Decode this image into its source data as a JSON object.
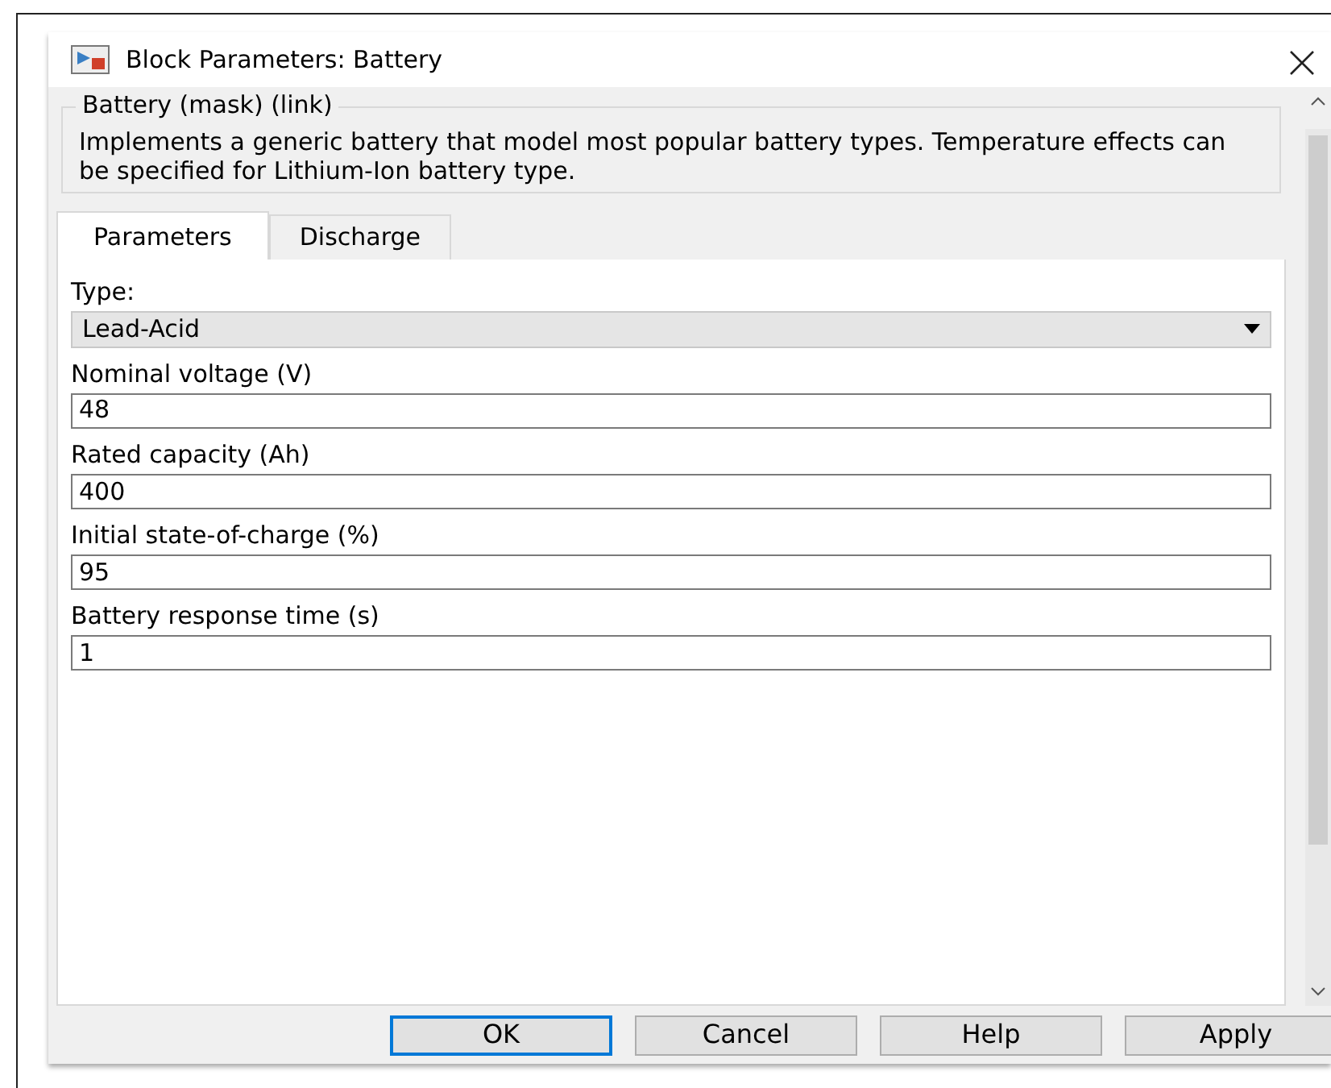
{
  "window": {
    "title": "Block Parameters: Battery"
  },
  "description": {
    "title": "Battery (mask) (link)",
    "text": "Implements a generic battery that model most popular battery types. Temperature effects can be specified for Lithium-Ion battery type."
  },
  "tabs": [
    {
      "label": "Parameters",
      "selected": true
    },
    {
      "label": "Discharge",
      "selected": false
    }
  ],
  "parameters": [
    {
      "kind": "dropdown",
      "label": "Type:",
      "value": "Lead-Acid"
    },
    {
      "kind": "text",
      "label": "Nominal voltage (V)",
      "value": "48"
    },
    {
      "kind": "text",
      "label": "Rated capacity (Ah)",
      "value": "400"
    },
    {
      "kind": "text",
      "label": "Initial state-of-charge (%)",
      "value": "95"
    },
    {
      "kind": "text",
      "label": "Battery response time (s)",
      "value": "1"
    }
  ],
  "buttons": [
    {
      "label": "OK",
      "selected": true
    },
    {
      "label": "Cancel",
      "selected": false
    },
    {
      "label": "Help",
      "selected": false
    },
    {
      "label": "Apply",
      "selected": false
    }
  ]
}
